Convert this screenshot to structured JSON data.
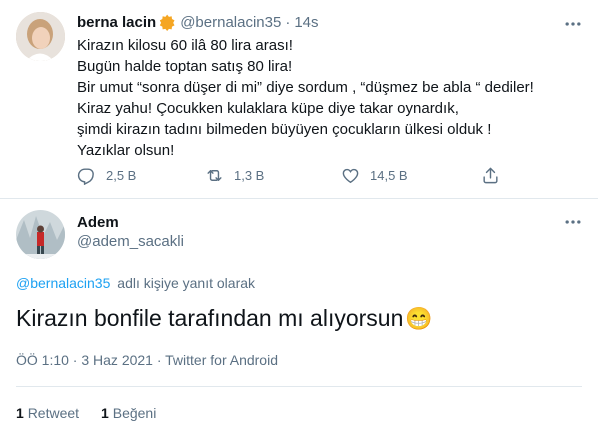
{
  "tweet": {
    "author_name": "berna lacin",
    "author_handle": "@bernalacin35",
    "separator": "·",
    "time": "14s",
    "text": "Kirazın kilosu 60 ilâ 80 lira arası!\nBugün halde toptan satış 80 lira!\nBir umut “sonra düşer di mi” diye sordum , “düşmez be abla “ dediler!\nKiraz yahu! Çocukken kulaklara küpe diye takar oynardık,\nşimdi kirazın tadını bilmeden büyüyen çocukların ülkesi olduk !\nYazıklar olsun!",
    "actions": {
      "replies": "2,5 B",
      "retweets": "1,3 B",
      "likes": "14,5 B"
    },
    "colors": {
      "verified_badge": "#f5a623"
    }
  },
  "reply": {
    "author_name": "Adem",
    "author_handle": "@adem_sacakli",
    "reply_context_handle": "@bernalacin35",
    "reply_context_text": "adlı kişiye yanıt olarak",
    "text": "Kirazın bonfile tarafından mı alıyorsun",
    "emoji": "😁",
    "meta": "ÖÖ 1:10 · 3 Haz 2021 · Twitter for Android",
    "stats": {
      "retweet_count": "1",
      "retweet_label": "Retweet",
      "like_count": "1",
      "like_label": "Beğeni"
    }
  },
  "icons": [
    "more-icon",
    "reply-icon",
    "retweet-icon",
    "like-icon",
    "share-icon",
    "verified-badge-icon"
  ],
  "colors": {
    "link": "#1da1f2",
    "muted": "#5b7083",
    "text": "#0f1419",
    "divider": "#e1e8ed"
  }
}
